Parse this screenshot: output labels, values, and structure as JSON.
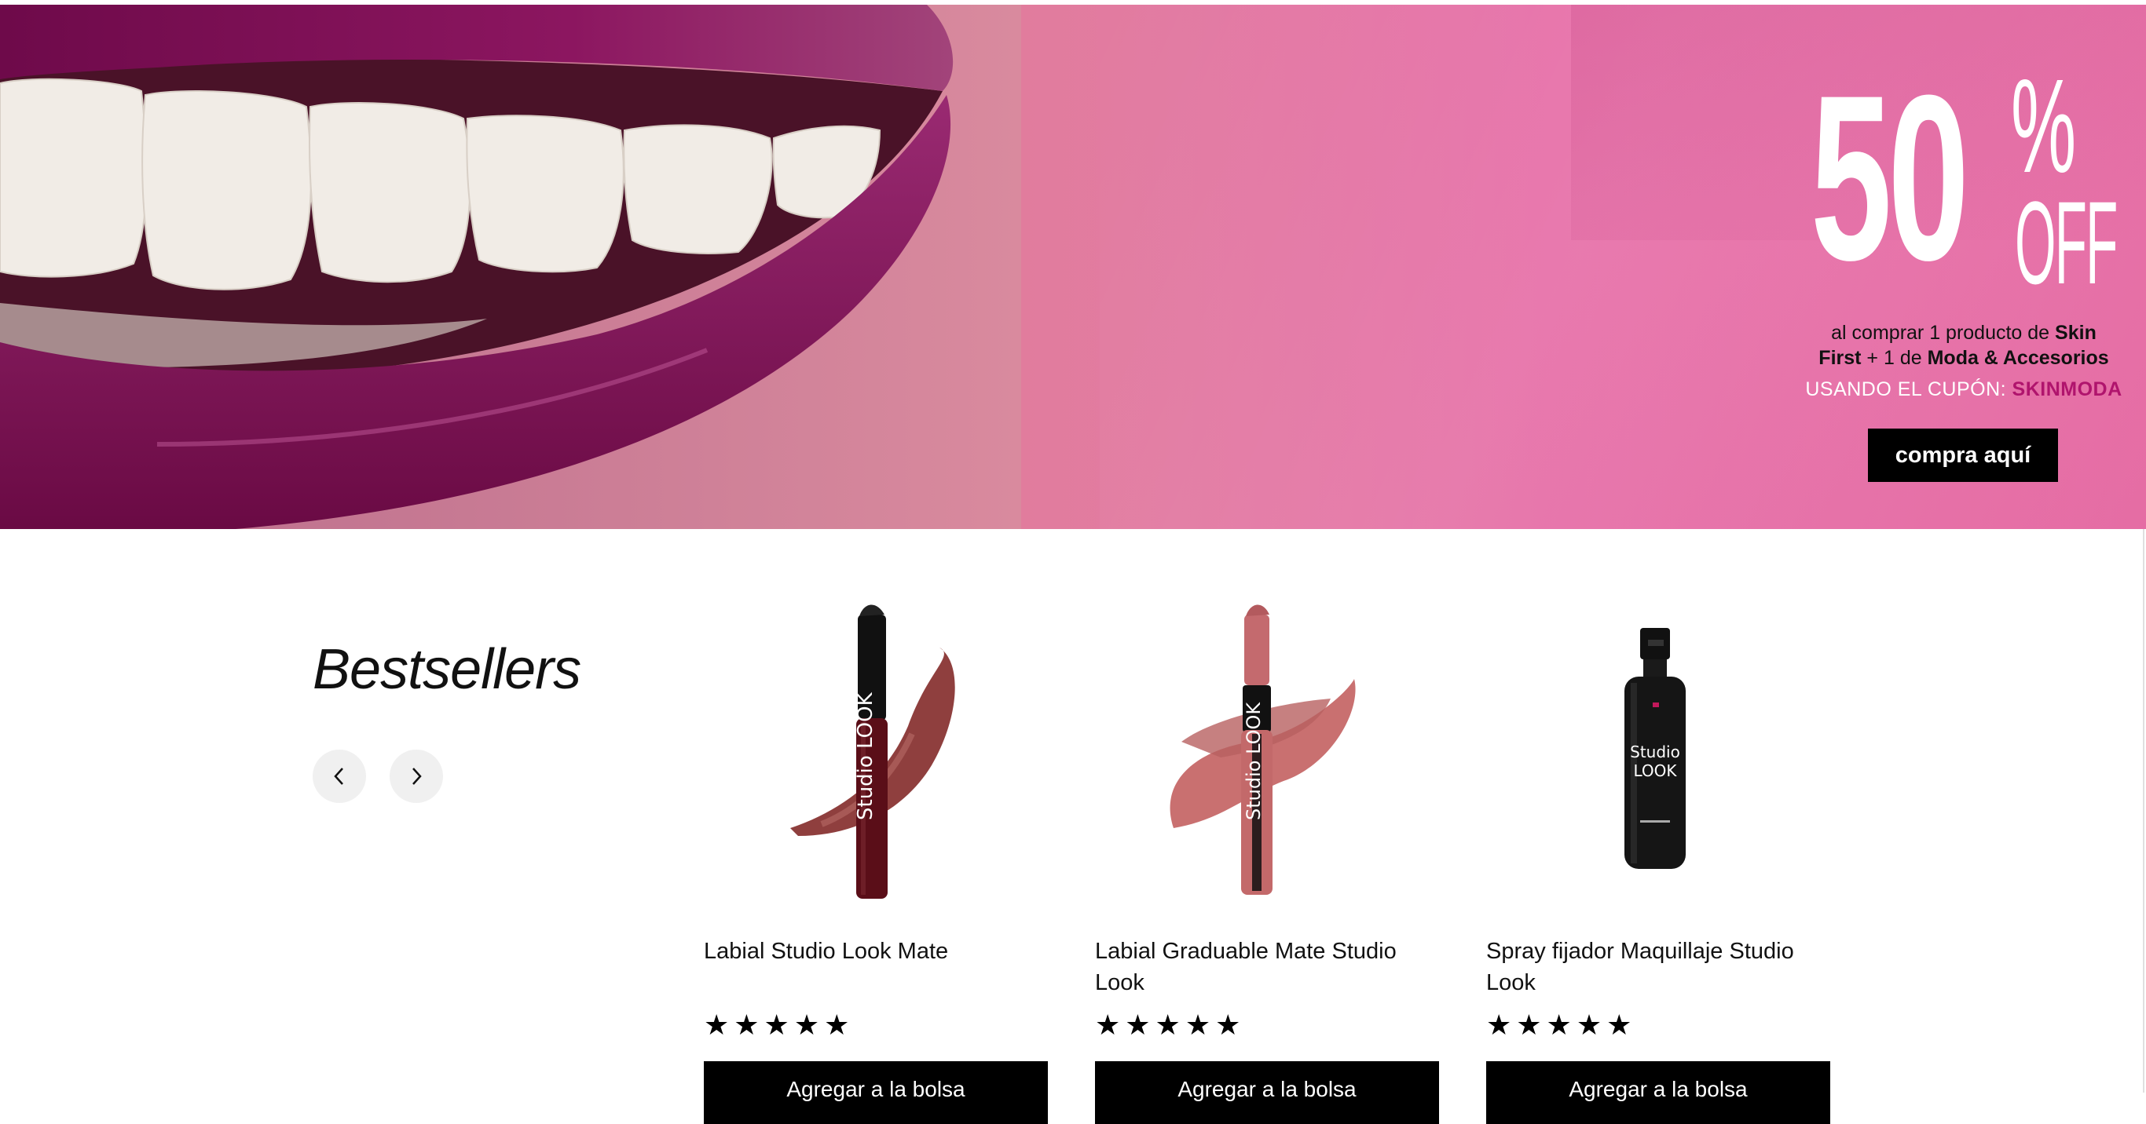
{
  "banner": {
    "big_number": "50",
    "percent": "%",
    "off": "OFF",
    "desc_pre": "al comprar 1 producto de ",
    "desc_b1": "Skin",
    "desc_b2": "First",
    "desc_mid": " + 1 de ",
    "desc_b3": "Moda & Accesorios",
    "coupon_label": "USANDO EL CUPÓN: ",
    "coupon_code": "SKINMODA",
    "cta_label": "compra aquí",
    "colors": {
      "accent": "#b0146d",
      "cta_bg": "#000000"
    }
  },
  "bestsellers": {
    "title": "Bestsellers",
    "prev_icon": "chevron-left-icon",
    "next_icon": "chevron-right-icon",
    "products": [
      {
        "name": "Labial Studio Look Mate",
        "stars": "★★★★★",
        "rating": 5,
        "add_label": "Agregar a la bolsa",
        "image": "lipstick-dark"
      },
      {
        "name": "Labial Graduable Mate Studio Look",
        "stars": "★★★★★",
        "rating": 5,
        "add_label": "Agregar a la bolsa",
        "image": "lipstick-pink"
      },
      {
        "name": "Spray fijador Maquillaje Studio Look",
        "stars": "★★★★★",
        "rating": 5,
        "add_label": "Agregar a la bolsa",
        "image": "setting-spray"
      }
    ]
  }
}
